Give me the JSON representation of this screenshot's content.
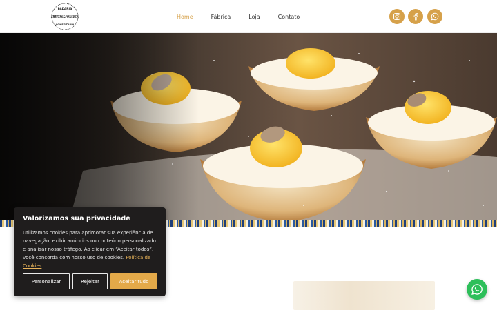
{
  "brand": {
    "top_text": "PADARIA",
    "name": "FREITAS&FONSECA",
    "bottom_text": "CONFEITARIA"
  },
  "nav": {
    "items": [
      {
        "label": "Home",
        "active": true
      },
      {
        "label": "Fábrica",
        "active": false
      },
      {
        "label": "Loja",
        "active": false
      },
      {
        "label": "Contato",
        "active": false
      }
    ],
    "accent_color": "#d6a14a"
  },
  "social": {
    "icons": [
      "instagram-icon",
      "facebook-icon",
      "whatsapp-icon"
    ],
    "color": "#d6a14a"
  },
  "cookie_banner": {
    "title": "Valorizamos sua privacidade",
    "text": "Utilizamos cookies para aprimorar sua experiência de navegação, exibir anúncios ou conteúdo personalizado e analisar nosso tráfego. Ao clicar em “Aceitar todos”, você concorda com nosso uso de cookies.",
    "policy_link": "Política de Cookies",
    "buttons": {
      "customize": "Personalizar",
      "reject": "Rejeitar",
      "accept": "Aceitar tudo"
    },
    "accent_color": "#e3a949"
  },
  "floating_whatsapp": {
    "icon": "whatsapp-icon",
    "color": "#2dbf5a"
  }
}
